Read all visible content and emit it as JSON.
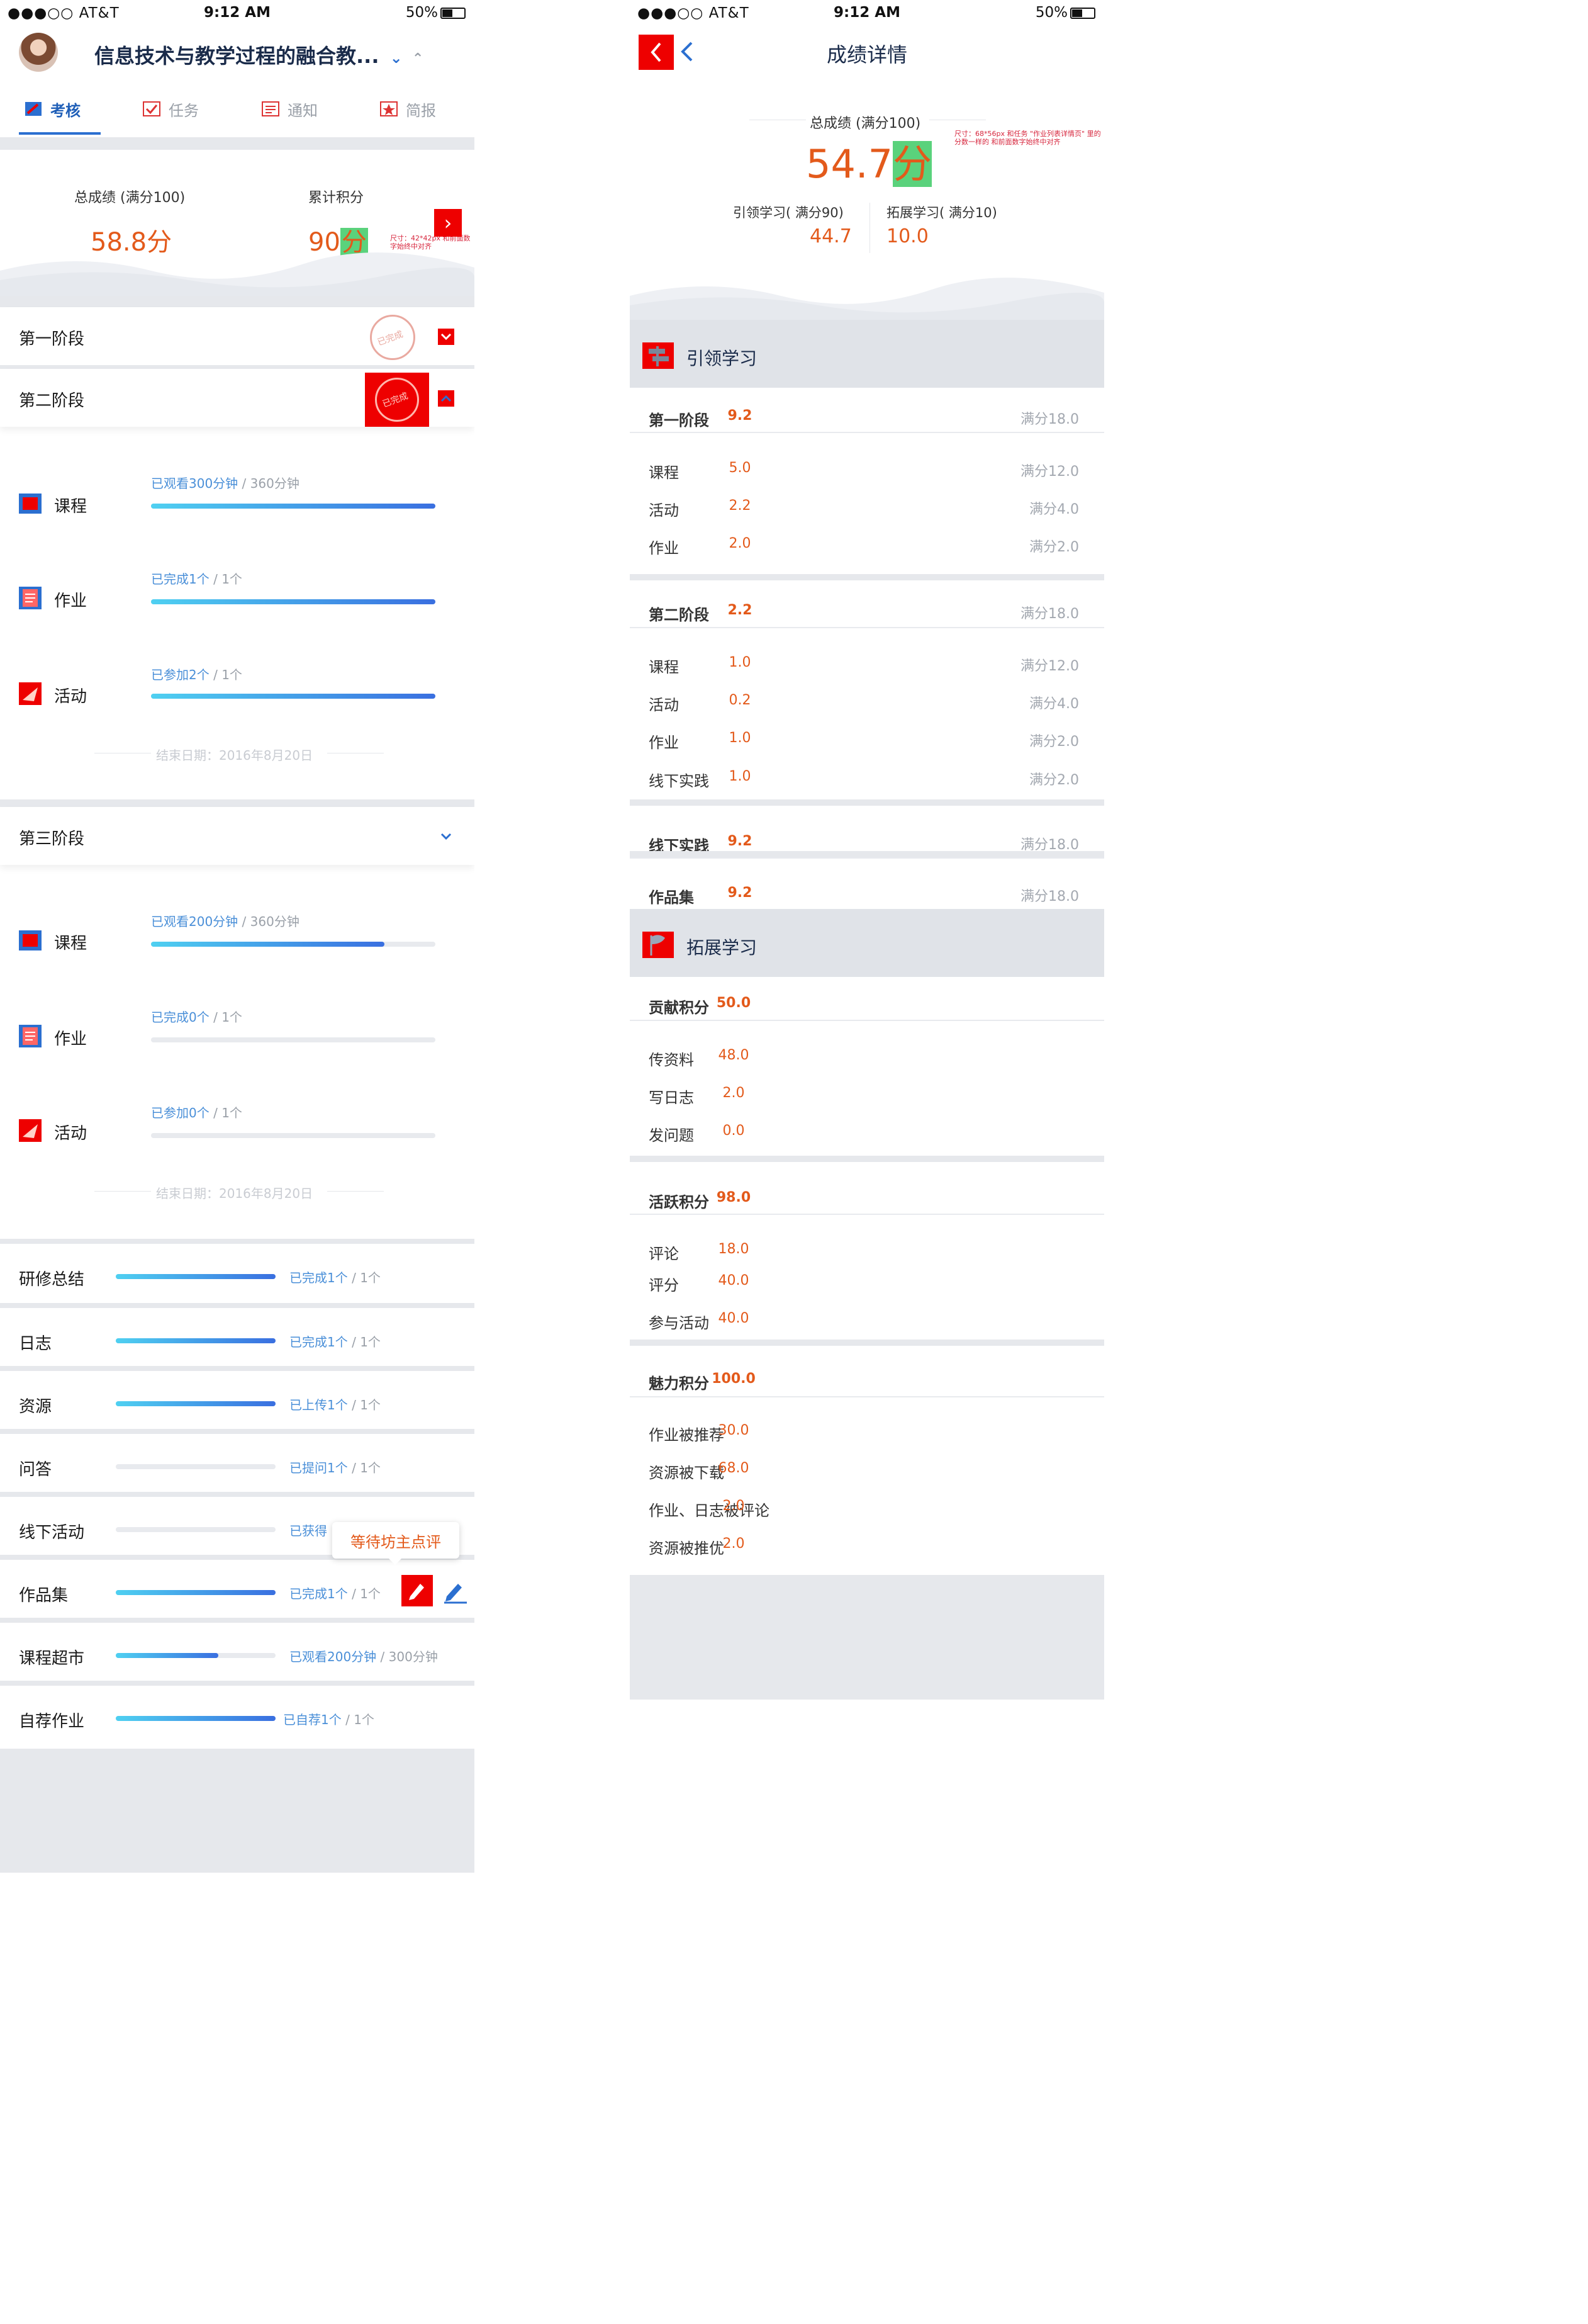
{
  "status_bar": {
    "carrier": "●●●○○ AT&T",
    "time": "9:12 AM",
    "battery": "50%"
  },
  "left": {
    "title": "信息技术与教学过程的融合教...",
    "tabs": [
      "考核",
      "任务",
      "通知",
      "简报"
    ],
    "total_label": "总成绩 (满分100)",
    "total_value": "58.8",
    "score_unit": "分",
    "points_label": "累计积分",
    "points_value": "90",
    "annotation_points": "尺寸：42*42px 和前面数字始终中对齐",
    "stage1": "第一阶段",
    "stage2": "第二阶段",
    "stage3": "第三阶段",
    "completed_stamp": "已完成",
    "stage2_items": [
      {
        "label": "课程",
        "done": "已观看300分钟",
        "total": " / 360分钟",
        "fill": 1.0
      },
      {
        "label": "作业",
        "done": "已完成1个",
        "total": " / 1个",
        "fill": 1.0
      },
      {
        "label": "活动",
        "done": "已参加2个",
        "total": " / 1个",
        "fill": 1.0
      }
    ],
    "stage3_items": [
      {
        "label": "课程",
        "done": "已观看200分钟",
        "total": " / 360分钟",
        "fill": 0.82
      },
      {
        "label": "作业",
        "done": "已完成0个",
        "total": " / 1个",
        "fill": 0
      },
      {
        "label": "活动",
        "done": "已参加0个",
        "total": " / 1个",
        "fill": 0
      }
    ],
    "end_date": "结束日期：2016年8月20日",
    "list": [
      {
        "label": "研修总结",
        "done": "已完成1个",
        "total": " / 1个",
        "fill": 1.0
      },
      {
        "label": "日志",
        "done": "已完成1个",
        "total": " / 1个",
        "fill": 1.0
      },
      {
        "label": "资源",
        "done": "已上传1个",
        "total": " / 1个",
        "fill": 1.0
      },
      {
        "label": "问答",
        "done": "已提问1个",
        "total": " / 1个",
        "fill": 0
      },
      {
        "label": "线下活动",
        "done": "已获得",
        "total": "",
        "fill": 0
      },
      {
        "label": "作品集",
        "done": "已完成1个",
        "total": " / 1个",
        "fill": 1.0
      },
      {
        "label": "课程超市",
        "done": "已观看200分钟",
        "total": " / 300分钟",
        "fill": 0.64
      },
      {
        "label": "自荐作业",
        "done": "已自荐1个",
        "total": " / 1个",
        "fill": 1.0
      }
    ],
    "tooltip": "等待坊主点评"
  },
  "right": {
    "title": "成绩详情",
    "total_label": "总成绩 (满分100)",
    "total_value": "54.7",
    "score_unit": "分",
    "annotation_total": "尺寸：68*56px 和任务 \"作业列表详情页\" 里的分数一样的 和前面数字始终中对齐",
    "lead_label": "引领学习( 满分90)",
    "lead_value": "44.7",
    "ext_label": "拓展学习( 满分10)",
    "ext_value": "10.0",
    "sec1": "引领学习",
    "sec2": "拓展学习",
    "rows1": [
      {
        "n": "第一阶段",
        "v": "9.2",
        "m": "满分18.0",
        "bold": true
      },
      {
        "n": "课程",
        "v": "5.0",
        "m": "满分12.0"
      },
      {
        "n": "活动",
        "v": "2.2",
        "m": "满分4.0"
      },
      {
        "n": "作业",
        "v": "2.0",
        "m": "满分2.0"
      },
      {
        "n": "第二阶段",
        "v": "2.2",
        "m": "满分18.0",
        "bold": true
      },
      {
        "n": "课程",
        "v": "1.0",
        "m": "满分12.0"
      },
      {
        "n": "活动",
        "v": "0.2",
        "m": "满分4.0"
      },
      {
        "n": "作业",
        "v": "1.0",
        "m": "满分2.0"
      },
      {
        "n": "线下实践",
        "v": "1.0",
        "m": "满分2.0"
      },
      {
        "n": "线下实践",
        "v": "9.2",
        "m": "满分18.0",
        "bold": true
      },
      {
        "n": "作品集",
        "v": "9.2",
        "m": "满分18.0",
        "bold": true
      }
    ],
    "rows2": [
      {
        "n": "贡献积分",
        "v": "50.0",
        "bold": true
      },
      {
        "n": "传资料",
        "v": "48.0"
      },
      {
        "n": "写日志",
        "v": "2.0"
      },
      {
        "n": "发问题",
        "v": "0.0"
      },
      {
        "n": "活跃积分",
        "v": "98.0",
        "bold": true
      },
      {
        "n": "评论",
        "v": "18.0"
      },
      {
        "n": "评分",
        "v": "40.0"
      },
      {
        "n": "参与活动",
        "v": "40.0"
      },
      {
        "n": "魅力积分",
        "v": "100.0",
        "bold": true
      },
      {
        "n": "作业被推荐",
        "v": "30.0"
      },
      {
        "n": "资源被下载",
        "v": "68.0"
      },
      {
        "n": "作业、日志被评论",
        "v": "2.0"
      },
      {
        "n": "资源被推优",
        "v": "2.0"
      }
    ]
  }
}
